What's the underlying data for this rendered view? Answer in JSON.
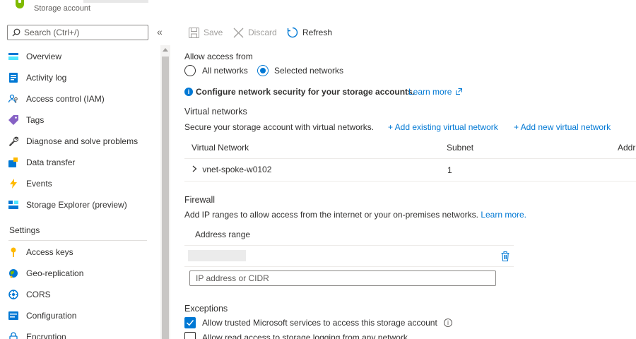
{
  "header": {
    "subtitle": "Storage account"
  },
  "search": {
    "placeholder": "Search (Ctrl+/)",
    "collapse": "«"
  },
  "nav": {
    "items": [
      {
        "label": "Overview",
        "icon": "overview-icon"
      },
      {
        "label": "Activity log",
        "icon": "activity-log-icon"
      },
      {
        "label": "Access control (IAM)",
        "icon": "access-control-icon"
      },
      {
        "label": "Tags",
        "icon": "tag-icon"
      },
      {
        "label": "Diagnose and solve problems",
        "icon": "wrench-icon"
      },
      {
        "label": "Data transfer",
        "icon": "data-transfer-icon"
      },
      {
        "label": "Events",
        "icon": "lightning-icon"
      },
      {
        "label": "Storage Explorer (preview)",
        "icon": "storage-explorer-icon"
      }
    ],
    "settings_heading": "Settings",
    "settings_items": [
      {
        "label": "Access keys",
        "icon": "key-icon"
      },
      {
        "label": "Geo-replication",
        "icon": "globe-icon"
      },
      {
        "label": "CORS",
        "icon": "cors-icon"
      },
      {
        "label": "Configuration",
        "icon": "configuration-icon"
      },
      {
        "label": "Encryption",
        "icon": "lock-icon"
      }
    ]
  },
  "toolbar": {
    "save": "Save",
    "discard": "Discard",
    "refresh": "Refresh"
  },
  "access": {
    "heading": "Allow access from",
    "option_all": "All networks",
    "option_selected": "Selected networks",
    "selected": "Selected networks"
  },
  "info": {
    "text": "Configure network security for your storage accounts.",
    "link": "Learn more"
  },
  "vnet": {
    "heading": "Virtual networks",
    "description": "Secure your storage account with virtual networks.",
    "add_existing": "+ Add existing virtual network",
    "add_new": "+ Add new virtual network",
    "columns": [
      "Virtual Network",
      "Subnet",
      "Addr"
    ],
    "rows": [
      {
        "name": "vnet-spoke-w0102",
        "subnet": "1"
      }
    ]
  },
  "firewall": {
    "heading": "Firewall",
    "description": "Add IP ranges to allow access from the internet or your on-premises networks.",
    "learn_more": "Learn more.",
    "column": "Address range",
    "placeholder": "IP address or CIDR"
  },
  "exceptions": {
    "heading": "Exceptions",
    "options": [
      {
        "label": "Allow trusted Microsoft services to access this storage account",
        "checked": true
      },
      {
        "label": "Allow read access to storage logging from any network",
        "checked": false
      }
    ]
  },
  "colors": {
    "accent": "#0078d4",
    "text": "#323130",
    "muted": "#605e5c"
  }
}
